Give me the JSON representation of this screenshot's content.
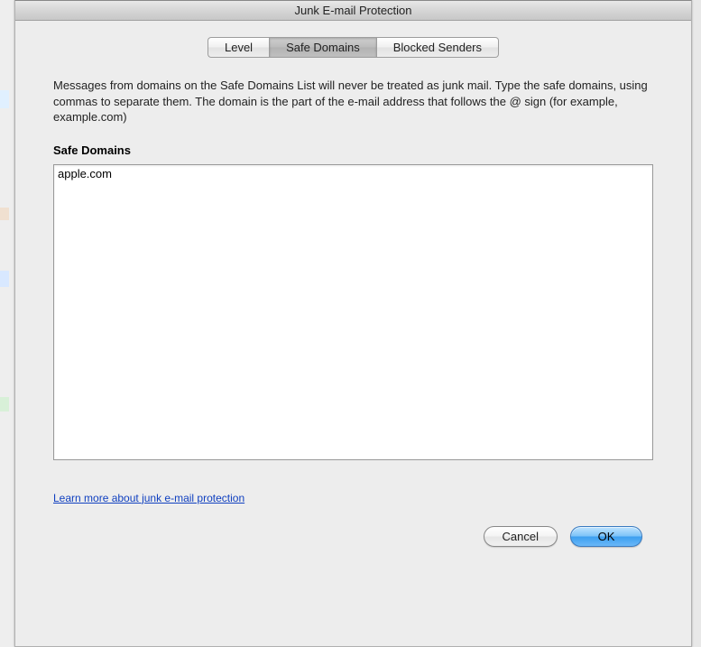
{
  "window": {
    "title": "Junk E-mail Protection"
  },
  "tabs": {
    "items": [
      {
        "label": "Level"
      },
      {
        "label": "Safe Domains"
      },
      {
        "label": "Blocked Senders"
      }
    ],
    "active_index": 1
  },
  "description": "Messages from domains on the Safe Domains List will never be treated as junk mail. Type the safe domains, using commas to separate them.  The domain is the part of the e-mail address that follows the @ sign (for example, example.com)",
  "section_label": "Safe Domains",
  "textarea_value": "apple.com",
  "help_link": "Learn more about junk e-mail protection",
  "buttons": {
    "cancel": "Cancel",
    "ok": "OK"
  }
}
